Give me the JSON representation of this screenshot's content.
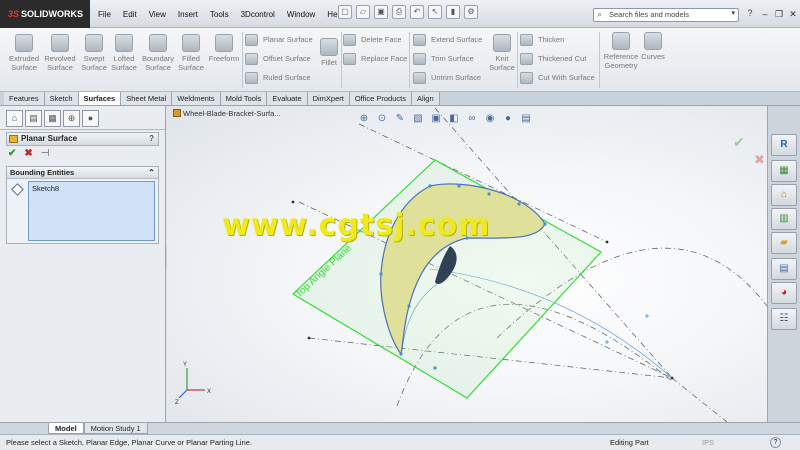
{
  "app": {
    "brand_prefix": "3S",
    "brand": "SOLIDWORKS"
  },
  "menu": [
    "File",
    "Edit",
    "View",
    "Insert",
    "Tools",
    "3Dcontrol",
    "Window",
    "Help"
  ],
  "quick_access": [
    "pin-icon",
    "new-icon",
    "open-icon",
    "save-icon",
    "print-icon",
    "undo-icon",
    "select-icon",
    "rebuild-icon",
    "options-icon"
  ],
  "search": {
    "placeholder": "Search files and models"
  },
  "ribbon": {
    "large": [
      {
        "label": "Extruded Surface"
      },
      {
        "label": "Revolved Surface"
      },
      {
        "label": "Swept Surface"
      },
      {
        "label": "Lofted Surface"
      },
      {
        "label": "Boundary Surface"
      },
      {
        "label": "Filled Surface"
      },
      {
        "label": "Freeform"
      }
    ],
    "group2": [
      "Planar Surface",
      "Offset Surface",
      "Ruled Surface"
    ],
    "fillet": "Fillet",
    "group3": [
      "Delete Face",
      "Replace Face"
    ],
    "group4": [
      "Extend Surface",
      "Trim Surface",
      "Untrim Surface"
    ],
    "knit": "Knit Surface",
    "group5": [
      "Thicken",
      "Thickened Cut",
      "Cut With Surface"
    ],
    "refgeo": "Reference Geometry",
    "curves": "Curves"
  },
  "cm_tabs": [
    "Features",
    "Sketch",
    "Surfaces",
    "Sheet Metal",
    "Weldments",
    "Mold Tools",
    "Evaluate",
    "DimXpert",
    "Office Products",
    "Align"
  ],
  "cm_active": "Surfaces",
  "property_manager": {
    "title": "Planar Surface",
    "help": "?",
    "group_title": "Bounding Entities",
    "selection": "Sketch8"
  },
  "viewport": {
    "document": "Wheel-Blade-Bracket-Surfa...",
    "plane_label": "Top Angle Plane",
    "watermark": "www.cgtsj.com"
  },
  "taskpane": [
    "resources-icon",
    "design-library-icon",
    "file-explorer-icon",
    "view-palette-icon",
    "folder-icon",
    "custom-properties-icon",
    "appearances-icon",
    "forum-icon"
  ],
  "bottom_tabs": [
    "Model",
    "Motion Study 1"
  ],
  "status": {
    "message": "Please select a Sketch, Planar Edge, Planar Curve or Planar Parting Line.",
    "mode": "Editing Part",
    "units": "IPS",
    "help": "?"
  },
  "colors": {
    "accent": "#2a9a2a",
    "plane": "#33dd33",
    "surface": "#d6d98f",
    "watermark": "#f0ea1c"
  }
}
